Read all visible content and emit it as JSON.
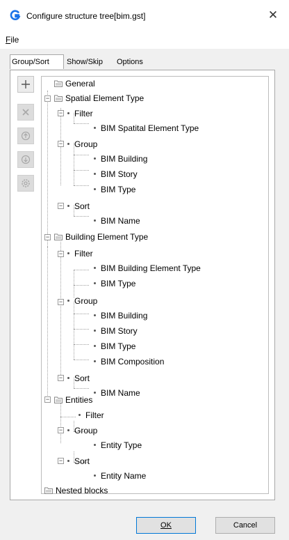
{
  "window": {
    "title": "Configure structure tree[bim.gst]",
    "close_glyph": "✕",
    "accent": "#1a73e8"
  },
  "menu": {
    "file": "File"
  },
  "tabs": [
    {
      "label": "Group/Sort",
      "active": true
    },
    {
      "label": "Show/Skip",
      "active": false
    },
    {
      "label": "Options",
      "active": false
    }
  ],
  "toolbar": {
    "add": {
      "icon": "plus-icon",
      "enabled": true
    },
    "delete": {
      "icon": "delete-icon",
      "enabled": false
    },
    "move_up": {
      "icon": "move-up-icon",
      "enabled": false
    },
    "move_down": {
      "icon": "move-down-icon",
      "enabled": false
    },
    "settings": {
      "icon": "gear-icon",
      "enabled": false
    }
  },
  "tree": {
    "general": "General",
    "spatial": "Spatial Element Type",
    "spatial_filter": "Filter",
    "spatial_filter_1": "BIM Spatital Element Type",
    "spatial_group": "Group",
    "spatial_group_1": "BIM Building",
    "spatial_group_2": "BIM Story",
    "spatial_group_3": "BIM Type",
    "spatial_sort": "Sort",
    "spatial_sort_1": "BIM Name",
    "building": "Building Element Type",
    "building_filter": "Filter",
    "building_filter_1": "BIM Building Element Type",
    "building_filter_2": "BIM Type",
    "building_group": "Group",
    "building_group_1": "BIM Building",
    "building_group_2": "BIM Story",
    "building_group_3": "BIM Type",
    "building_group_4": "BIM Composition",
    "building_sort": "Sort",
    "building_sort_1": "BIM Name",
    "entities": "Entities",
    "entities_filter": "Filter",
    "entities_group": "Group",
    "entities_group_1": "Entity Type",
    "entities_sort": "Sort",
    "entities_sort_1": "Entity Name",
    "nested": "Nested blocks"
  },
  "buttons": {
    "ok": "OK",
    "cancel": "Cancel"
  }
}
